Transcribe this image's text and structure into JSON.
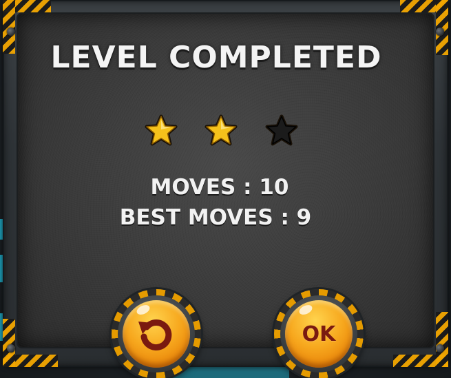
{
  "dialog": {
    "title": "LEVEL COMPLETED"
  },
  "rating": {
    "earned": 2,
    "total": 3
  },
  "stats": {
    "moves_text": "MOVES : 10",
    "best_moves_text": "BEST MOVES : 9"
  },
  "buttons": {
    "replay_icon": "replay-icon",
    "ok_label": "OK"
  },
  "colors": {
    "star_gold": "#f5c21b",
    "star_empty": "#1b1b1b",
    "button_orange": "#f7a81e",
    "hazard_yellow": "#f2a600",
    "text_white": "#f4f4f4",
    "button_text": "#7a1a10"
  }
}
